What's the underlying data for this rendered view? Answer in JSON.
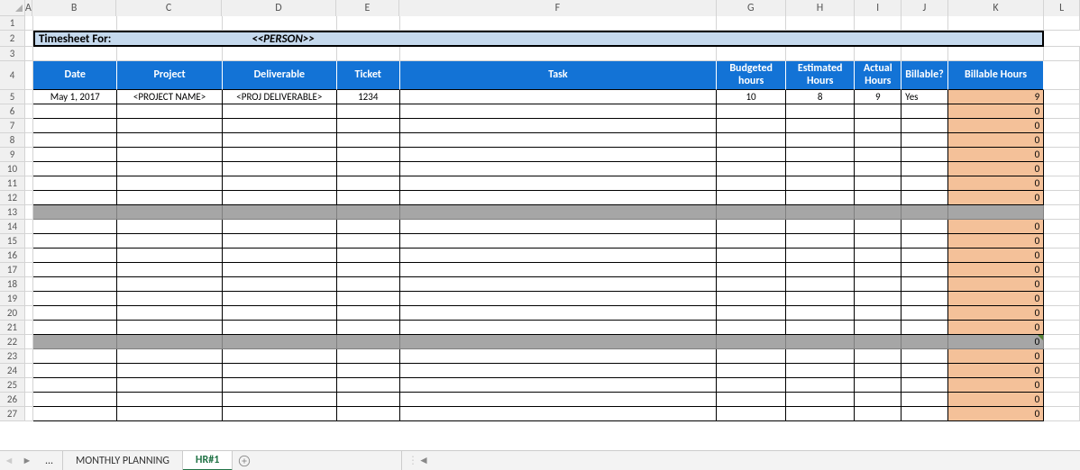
{
  "columns": [
    "A",
    "B",
    "C",
    "D",
    "E",
    "F",
    "G",
    "H",
    "I",
    "J",
    "K",
    "L"
  ],
  "row_numbers_start": 1,
  "row_numbers_end": 27,
  "title": {
    "label": "Timesheet For:",
    "person": "<<PERSON>>"
  },
  "headers": {
    "date": "Date",
    "project": "Project",
    "deliverable": "Deliverable",
    "ticket": "Ticket",
    "task": "Task",
    "budgeted": "Budgeted hours",
    "estimated": "Estimated Hours",
    "actual": "Actual Hours",
    "billable": "Billable?",
    "billable_hours": "Billable Hours"
  },
  "chart_data": {
    "type": "table",
    "title": "Timesheet For: <<PERSON>>",
    "columns": [
      "Date",
      "Project",
      "Deliverable",
      "Ticket",
      "Task",
      "Budgeted hours",
      "Estimated Hours",
      "Actual Hours",
      "Billable?",
      "Billable Hours"
    ],
    "rows": [
      {
        "row": 5,
        "kind": "data",
        "date": "May 1, 2017",
        "project": "<PROJECT NAME>",
        "deliverable": "<PROJ DELIVERABLE>",
        "ticket": "1234",
        "task": "",
        "budgeted": "10",
        "estimated": "8",
        "actual": "9",
        "billable": "Yes",
        "billable_hours": "9"
      },
      {
        "row": 6,
        "kind": "data",
        "date": "",
        "project": "",
        "deliverable": "",
        "ticket": "",
        "task": "",
        "budgeted": "",
        "estimated": "",
        "actual": "",
        "billable": "",
        "billable_hours": "0"
      },
      {
        "row": 7,
        "kind": "data",
        "date": "",
        "project": "",
        "deliverable": "",
        "ticket": "",
        "task": "",
        "budgeted": "",
        "estimated": "",
        "actual": "",
        "billable": "",
        "billable_hours": "0"
      },
      {
        "row": 8,
        "kind": "data",
        "date": "",
        "project": "",
        "deliverable": "",
        "ticket": "",
        "task": "",
        "budgeted": "",
        "estimated": "",
        "actual": "",
        "billable": "",
        "billable_hours": "0"
      },
      {
        "row": 9,
        "kind": "data",
        "date": "",
        "project": "",
        "deliverable": "",
        "ticket": "",
        "task": "",
        "budgeted": "",
        "estimated": "",
        "actual": "",
        "billable": "",
        "billable_hours": "0"
      },
      {
        "row": 10,
        "kind": "data",
        "date": "",
        "project": "",
        "deliverable": "",
        "ticket": "",
        "task": "",
        "budgeted": "",
        "estimated": "",
        "actual": "",
        "billable": "",
        "billable_hours": "0"
      },
      {
        "row": 11,
        "kind": "data",
        "date": "",
        "project": "",
        "deliverable": "",
        "ticket": "",
        "task": "",
        "budgeted": "",
        "estimated": "",
        "actual": "",
        "billable": "",
        "billable_hours": "0"
      },
      {
        "row": 12,
        "kind": "data",
        "date": "",
        "project": "",
        "deliverable": "",
        "ticket": "",
        "task": "",
        "budgeted": "",
        "estimated": "",
        "actual": "",
        "billable": "",
        "billable_hours": "0"
      },
      {
        "row": 13,
        "kind": "separator",
        "date": "",
        "project": "",
        "deliverable": "",
        "ticket": "",
        "task": "",
        "budgeted": "",
        "estimated": "",
        "actual": "",
        "billable": "",
        "billable_hours": ""
      },
      {
        "row": 14,
        "kind": "data",
        "date": "",
        "project": "",
        "deliverable": "",
        "ticket": "",
        "task": "",
        "budgeted": "",
        "estimated": "",
        "actual": "",
        "billable": "",
        "billable_hours": "0"
      },
      {
        "row": 15,
        "kind": "data",
        "date": "",
        "project": "",
        "deliverable": "",
        "ticket": "",
        "task": "",
        "budgeted": "",
        "estimated": "",
        "actual": "",
        "billable": "",
        "billable_hours": "0"
      },
      {
        "row": 16,
        "kind": "data",
        "date": "",
        "project": "",
        "deliverable": "",
        "ticket": "",
        "task": "",
        "budgeted": "",
        "estimated": "",
        "actual": "",
        "billable": "",
        "billable_hours": "0"
      },
      {
        "row": 17,
        "kind": "data",
        "date": "",
        "project": "",
        "deliverable": "",
        "ticket": "",
        "task": "",
        "budgeted": "",
        "estimated": "",
        "actual": "",
        "billable": "",
        "billable_hours": "0"
      },
      {
        "row": 18,
        "kind": "data",
        "date": "",
        "project": "",
        "deliverable": "",
        "ticket": "",
        "task": "",
        "budgeted": "",
        "estimated": "",
        "actual": "",
        "billable": "",
        "billable_hours": "0"
      },
      {
        "row": 19,
        "kind": "data",
        "date": "",
        "project": "",
        "deliverable": "",
        "ticket": "",
        "task": "",
        "budgeted": "",
        "estimated": "",
        "actual": "",
        "billable": "",
        "billable_hours": "0"
      },
      {
        "row": 20,
        "kind": "data",
        "date": "",
        "project": "",
        "deliverable": "",
        "ticket": "",
        "task": "",
        "budgeted": "",
        "estimated": "",
        "actual": "",
        "billable": "",
        "billable_hours": "0"
      },
      {
        "row": 21,
        "kind": "data",
        "date": "",
        "project": "",
        "deliverable": "",
        "ticket": "",
        "task": "",
        "budgeted": "",
        "estimated": "",
        "actual": "",
        "billable": "",
        "billable_hours": "0"
      },
      {
        "row": 22,
        "kind": "separator",
        "date": "",
        "project": "",
        "deliverable": "",
        "ticket": "",
        "task": "",
        "budgeted": "",
        "estimated": "",
        "actual": "",
        "billable": "",
        "billable_hours": "0",
        "marker": true
      },
      {
        "row": 23,
        "kind": "data",
        "date": "",
        "project": "",
        "deliverable": "",
        "ticket": "",
        "task": "",
        "budgeted": "",
        "estimated": "",
        "actual": "",
        "billable": "",
        "billable_hours": "0"
      },
      {
        "row": 24,
        "kind": "data",
        "date": "",
        "project": "",
        "deliverable": "",
        "ticket": "",
        "task": "",
        "budgeted": "",
        "estimated": "",
        "actual": "",
        "billable": "",
        "billable_hours": "0"
      },
      {
        "row": 25,
        "kind": "data",
        "date": "",
        "project": "",
        "deliverable": "",
        "ticket": "",
        "task": "",
        "budgeted": "",
        "estimated": "",
        "actual": "",
        "billable": "",
        "billable_hours": "0"
      },
      {
        "row": 26,
        "kind": "data",
        "date": "",
        "project": "",
        "deliverable": "",
        "ticket": "",
        "task": "",
        "budgeted": "",
        "estimated": "",
        "actual": "",
        "billable": "",
        "billable_hours": "0"
      },
      {
        "row": 27,
        "kind": "data",
        "date": "",
        "project": "",
        "deliverable": "",
        "ticket": "",
        "task": "",
        "budgeted": "",
        "estimated": "",
        "actual": "",
        "billable": "",
        "billable_hours": "0"
      }
    ]
  },
  "tabs": {
    "ellipsis": "...",
    "monthly": "MONTHLY PLANNING",
    "hr1": "HR#1",
    "active": "HR#1"
  }
}
